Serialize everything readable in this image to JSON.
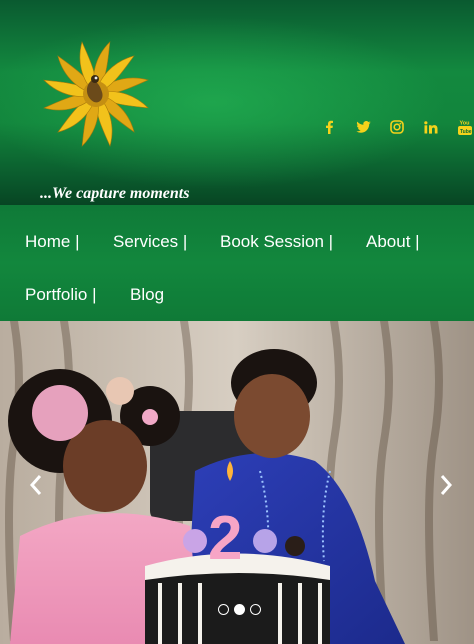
{
  "header": {
    "tagline": "...We capture moments",
    "social": [
      {
        "icon": "facebook-icon",
        "label": "f"
      },
      {
        "icon": "twitter-icon",
        "label": "twitter"
      },
      {
        "icon": "instagram-icon",
        "label": "instagram"
      },
      {
        "icon": "linkedin-icon",
        "label": "in"
      },
      {
        "icon": "youtube-icon",
        "label": "You Tube"
      }
    ]
  },
  "nav": {
    "items": [
      {
        "label": "Home |"
      },
      {
        "label": "Services |"
      },
      {
        "label": "Book Session |"
      },
      {
        "label": "About |"
      },
      {
        "label": "Portfolio |"
      },
      {
        "label": "Blog"
      }
    ]
  },
  "slider": {
    "slide_count": 3,
    "active_slide": 2
  },
  "colors": {
    "brand_green": "#12873d",
    "logo_gold": "#f2c21b",
    "social_yellow": "#f4d21b"
  }
}
